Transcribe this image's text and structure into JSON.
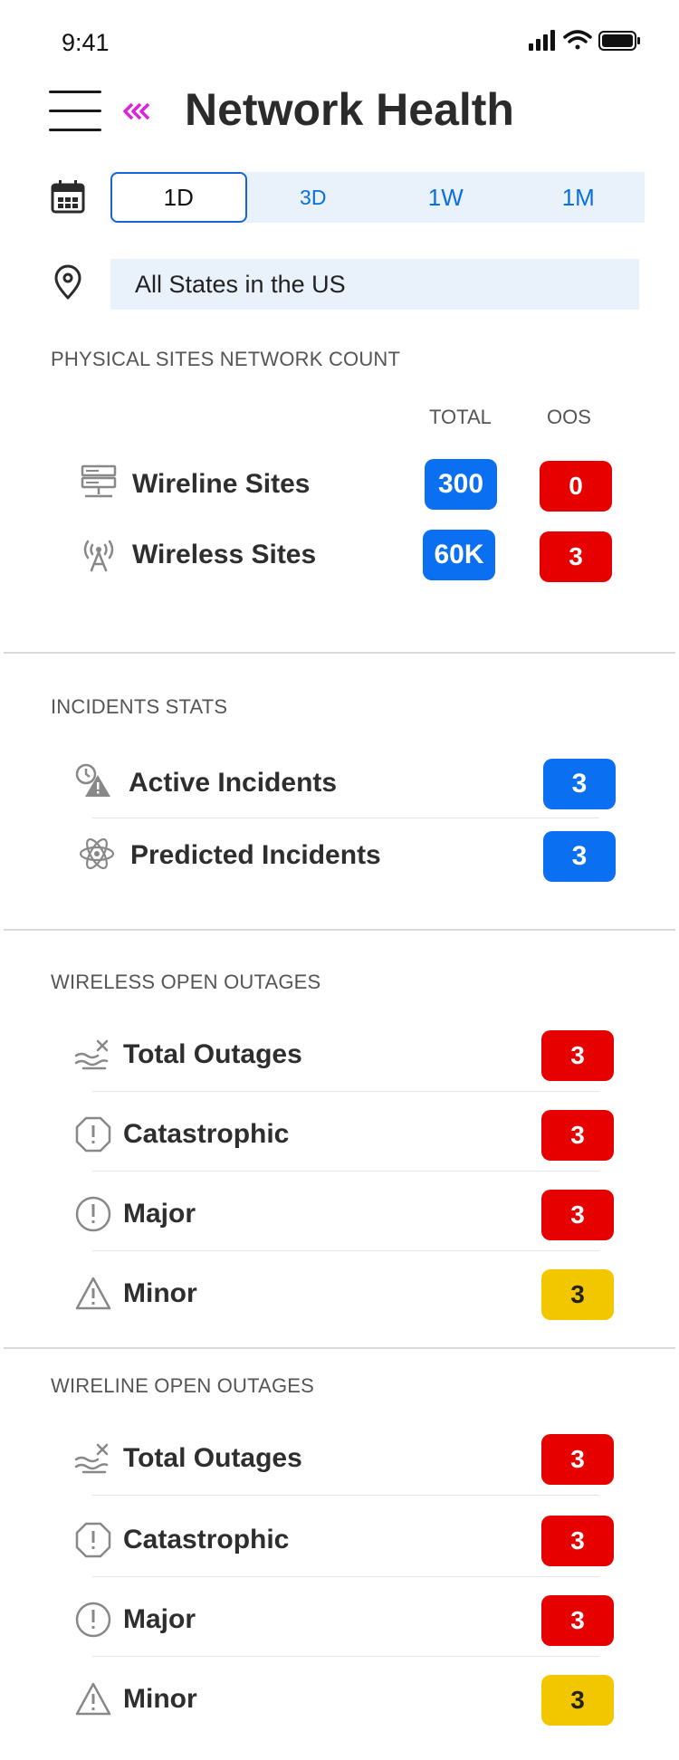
{
  "status_bar": {
    "time": "9:41"
  },
  "header": {
    "title": "Network Health"
  },
  "date_range": {
    "options": [
      "1D",
      "3D",
      "1W",
      "1M"
    ],
    "selected": "1D"
  },
  "location": {
    "value": "All States in the US"
  },
  "physical_sites": {
    "section_title": "PHYSICAL SITES NETWORK COUNT",
    "col_total": "TOTAL",
    "col_oos": "OOS",
    "rows": [
      {
        "label": "Wireline Sites",
        "total": "300",
        "oos": "0",
        "icon": "server-icon"
      },
      {
        "label": "Wireless Sites",
        "total": "60K",
        "oos": "3",
        "icon": "antenna-icon"
      }
    ]
  },
  "incidents": {
    "section_title": "INCIDENTS STATS",
    "rows": [
      {
        "label": "Active Incidents",
        "count": "3",
        "icon": "incident-alert-icon"
      },
      {
        "label": "Predicted Incidents",
        "count": "3",
        "icon": "atom-icon"
      }
    ]
  },
  "wireless_outages": {
    "section_title": "WIRELESS OPEN OUTAGES",
    "rows": [
      {
        "label": "Total Outages",
        "count": "3",
        "severity": "red",
        "icon": "outage-icon"
      },
      {
        "label": "Catastrophic",
        "count": "3",
        "severity": "red",
        "icon": "octagon-alert-icon"
      },
      {
        "label": "Major",
        "count": "3",
        "severity": "red",
        "icon": "circle-alert-icon"
      },
      {
        "label": "Minor",
        "count": "3",
        "severity": "yellow",
        "icon": "triangle-alert-icon"
      }
    ]
  },
  "wireline_outages": {
    "section_title": "WIRELINE OPEN OUTAGES",
    "rows": [
      {
        "label": "Total Outages",
        "count": "3",
        "severity": "red",
        "icon": "outage-icon"
      },
      {
        "label": "Catastrophic",
        "count": "3",
        "severity": "red",
        "icon": "octagon-alert-icon"
      },
      {
        "label": "Major",
        "count": "3",
        "severity": "red",
        "icon": "circle-alert-icon"
      },
      {
        "label": "Minor",
        "count": "3",
        "severity": "yellow",
        "icon": "triangle-alert-icon"
      }
    ]
  },
  "colors": {
    "accent_blue": "#0a6ff0",
    "alert_red": "#e60000",
    "warn_yellow": "#f2c700",
    "back_magenta": "#e020e0"
  }
}
